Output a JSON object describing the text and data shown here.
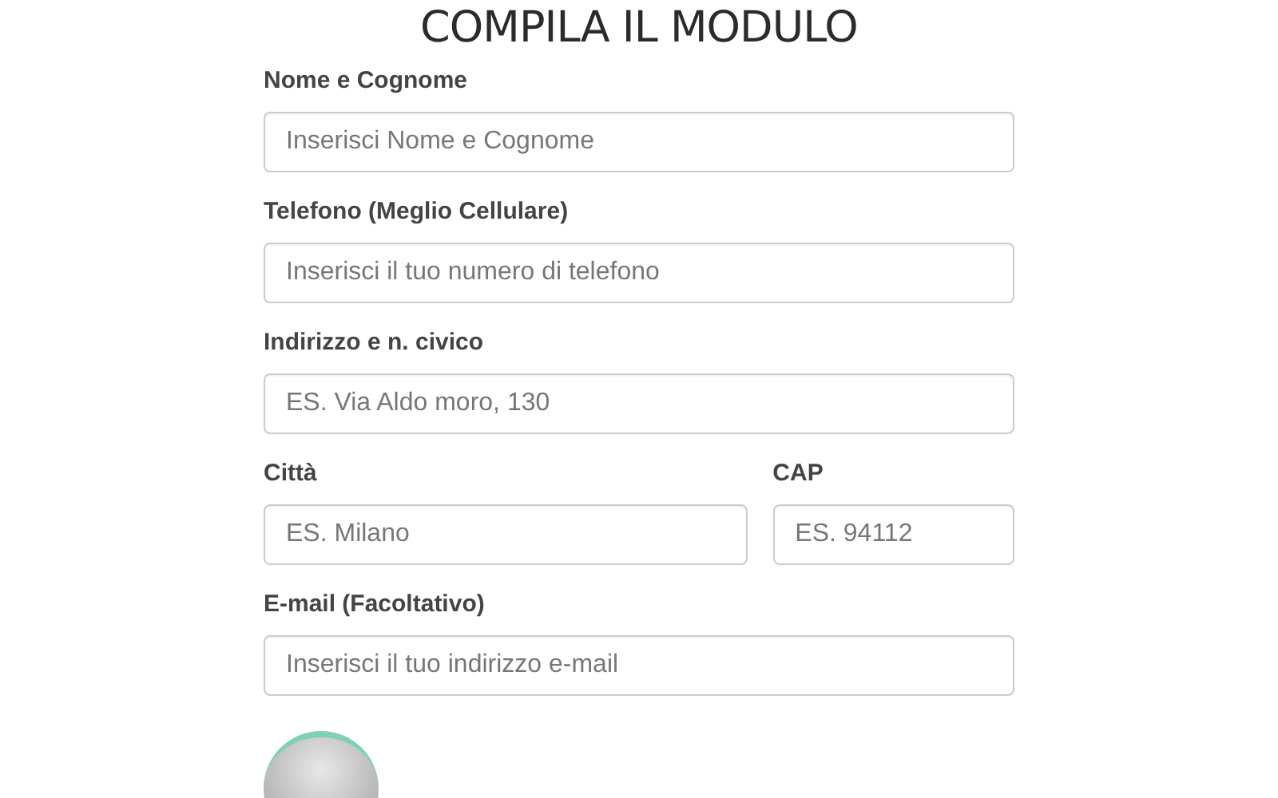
{
  "title": "COMPILA IL MODULO",
  "rows": [
    {
      "fields": [
        {
          "label": "Nome e Cognome",
          "placeholder": "Inserisci Nome e Cognome"
        }
      ]
    },
    {
      "fields": [
        {
          "label": "Telefono (Meglio Cellulare)",
          "placeholder": "Inserisci il tuo numero di telefono"
        }
      ]
    },
    {
      "fields": [
        {
          "label": "Indirizzo e n. civico",
          "placeholder": "ES. Via Aldo moro, 130"
        }
      ]
    },
    {
      "fields": [
        {
          "label": "Città",
          "placeholder": "ES. Milano"
        },
        {
          "label": "CAP",
          "placeholder": "ES. 94112"
        }
      ]
    },
    {
      "fields": [
        {
          "label": "E-mail (Facoltativo)",
          "placeholder": "Inserisci il tuo indirizzo e-mail"
        }
      ]
    }
  ]
}
